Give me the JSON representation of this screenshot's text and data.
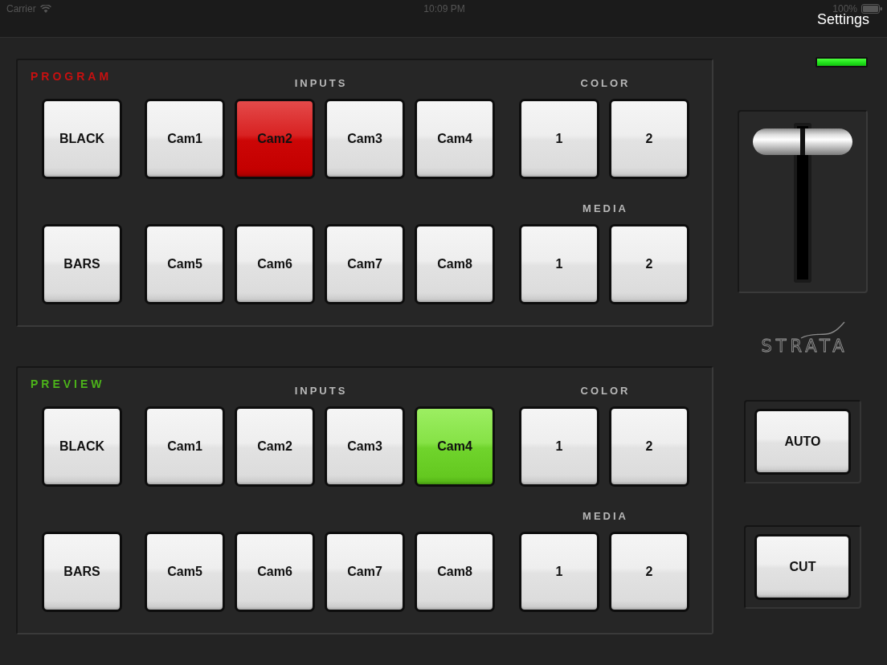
{
  "status_bar": {
    "carrier": "Carrier",
    "time": "10:09 PM",
    "battery": "100%"
  },
  "nav_bar": {
    "settings": "Settings"
  },
  "buses": [
    {
      "title": "PROGRAM",
      "kind": "program",
      "color": "#c81010",
      "sources": [
        {
          "label": "BLACK",
          "selected": false
        },
        {
          "label": "BARS",
          "selected": false
        }
      ],
      "inputs": {
        "heading": "INPUTS",
        "buttons": [
          {
            "label": "Cam1",
            "selected": false
          },
          {
            "label": "Cam2",
            "selected": true
          },
          {
            "label": "Cam3",
            "selected": false
          },
          {
            "label": "Cam4",
            "selected": false
          },
          {
            "label": "Cam5",
            "selected": false
          },
          {
            "label": "Cam6",
            "selected": false
          },
          {
            "label": "Cam7",
            "selected": false
          },
          {
            "label": "Cam8",
            "selected": false
          }
        ]
      },
      "colors": {
        "heading": "COLOR",
        "buttons": [
          {
            "label": "1",
            "selected": false
          },
          {
            "label": "2",
            "selected": false
          }
        ]
      },
      "media": {
        "heading": "MEDIA",
        "buttons": [
          {
            "label": "1",
            "selected": false
          },
          {
            "label": "2",
            "selected": false
          }
        ]
      }
    },
    {
      "title": "PREVIEW",
      "kind": "preview",
      "color": "#4cb31a",
      "sources": [
        {
          "label": "BLACK",
          "selected": false
        },
        {
          "label": "BARS",
          "selected": false
        }
      ],
      "inputs": {
        "heading": "INPUTS",
        "buttons": [
          {
            "label": "Cam1",
            "selected": false
          },
          {
            "label": "Cam2",
            "selected": false
          },
          {
            "label": "Cam3",
            "selected": false
          },
          {
            "label": "Cam4",
            "selected": true
          },
          {
            "label": "Cam5",
            "selected": false
          },
          {
            "label": "Cam6",
            "selected": false
          },
          {
            "label": "Cam7",
            "selected": false
          },
          {
            "label": "Cam8",
            "selected": false
          }
        ]
      },
      "colors": {
        "heading": "COLOR",
        "buttons": [
          {
            "label": "1",
            "selected": false
          },
          {
            "label": "2",
            "selected": false
          }
        ]
      },
      "media": {
        "heading": "MEDIA",
        "buttons": [
          {
            "label": "1",
            "selected": false
          },
          {
            "label": "2",
            "selected": false
          }
        ]
      }
    }
  ],
  "indicator": {
    "on": true
  },
  "fader": {
    "level": 1
  },
  "logo": {
    "text": "STRATA"
  },
  "transitions": [
    {
      "label": "AUTO"
    },
    {
      "label": "CUT"
    }
  ]
}
